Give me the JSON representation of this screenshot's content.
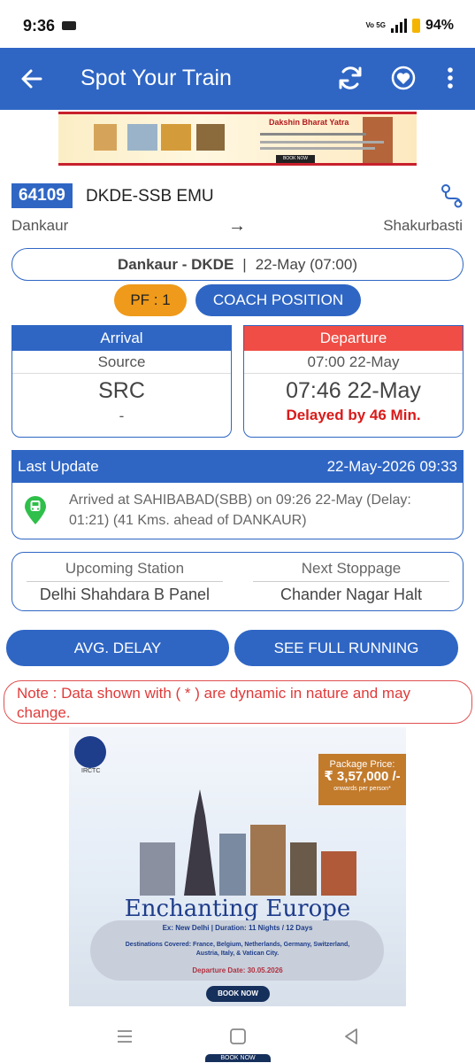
{
  "status_bar": {
    "time": "9:36",
    "network": "Vo 5G",
    "battery": "94%"
  },
  "app_bar": {
    "title": "Spot Your Train"
  },
  "top_banner": {
    "title": "Dakshin Bharat Yatra",
    "button": "BOOK NOW"
  },
  "train": {
    "number": "64109",
    "name": "DKDE-SSB EMU",
    "from": "Dankaur",
    "to": "Shakurbasti",
    "arrow": "→"
  },
  "station_pill": {
    "station": "Dankaur - DKDE",
    "separator": "|",
    "date_time": "22-May (07:00)"
  },
  "platform": {
    "label": "PF : 1"
  },
  "coach_button": "COACH POSITION",
  "arrival": {
    "header": "Arrival",
    "scheduled": "Source",
    "main": "SRC",
    "extra": "-"
  },
  "departure": {
    "header": "Departure",
    "scheduled": "07:00 22-May",
    "main": "07:46 22-May",
    "delay": "Delayed by 46 Min."
  },
  "last_update": {
    "label": "Last Update",
    "timestamp": "22-May-2026 09:33",
    "message": "Arrived at SAHIBABAD(SBB) on 09:26 22-May (Delay: 01:21) (41 Kms. ahead of DANKAUR)"
  },
  "upcoming": {
    "upcoming_label": "Upcoming Station",
    "upcoming_value": "Delhi Shahdara B Panel",
    "next_label": "Next Stoppage",
    "next_value": "Chander Nagar Halt"
  },
  "buttons": {
    "avg_delay": "AVG. DELAY",
    "full_running": "SEE FULL RUNNING"
  },
  "note": "Note : Data shown with ( * ) are dynamic in nature and may change.",
  "ad_banner": {
    "brand": "IRCTC",
    "price_label": "Package Price:",
    "price": "₹ 3,57,000 /-",
    "price_note": "onwards per person*",
    "heading": "Enchanting Europe",
    "line1": "Ex: New Delhi | Duration: 11 Nights / 12 Days",
    "line2": "Destinations Covered: France, Belgium, Netherlands, Germany, Switzerland, Austria, Italy, & Vatican City.",
    "line3": "Departure Date: 30.05.2026",
    "button": "BOOK NOW"
  },
  "bottom_peek": "BOOK NOW",
  "colors": {
    "primary": "#2f66c4",
    "departure": "#ef4d45",
    "pf": "#ef9a1a",
    "delay": "#d91a1a"
  }
}
